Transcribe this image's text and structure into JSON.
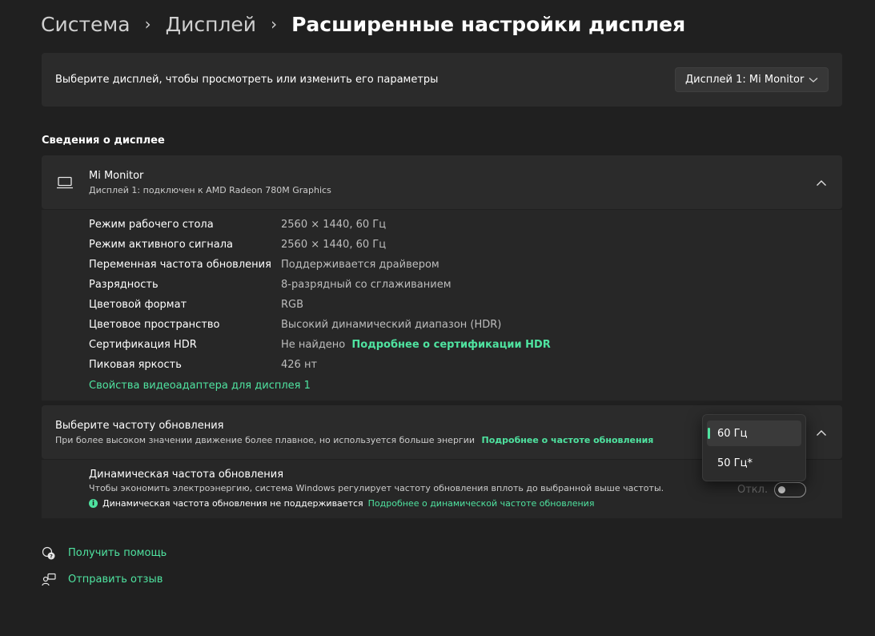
{
  "breadcrumb": {
    "items": [
      "Система",
      "Дисплей",
      "Расширенные настройки дисплея"
    ],
    "separator": "›"
  },
  "display_select": {
    "label": "Выберите дисплей, чтобы просмотреть или изменить его параметры",
    "value": "Дисплей 1: Mi Monitor"
  },
  "info_section": {
    "title": "Сведения о дисплее",
    "monitor_name": "Mi Monitor",
    "monitor_desc": "Дисплей 1: подключен к AMD Radeon 780M Graphics",
    "rows": [
      {
        "key": "Режим рабочего стола",
        "value": "2560 × 1440, 60 Гц"
      },
      {
        "key": "Режим активного сигнала",
        "value": "2560 × 1440, 60 Гц"
      },
      {
        "key": "Переменная частота обновления",
        "value": "Поддерживается драйвером"
      },
      {
        "key": "Разрядность",
        "value": "8-разрядный со сглаживанием"
      },
      {
        "key": "Цветовой формат",
        "value": "RGB"
      },
      {
        "key": "Цветовое пространство",
        "value": "Высокий динамический диапазон (HDR)"
      },
      {
        "key": "Сертификация HDR",
        "value": "Не найдено"
      },
      {
        "key": "Пиковая яркость",
        "value": "426 нт"
      }
    ],
    "hdr_link": "Подробнее о сертификации HDR",
    "adapter_link": "Свойства видеоадаптера для дисплея 1"
  },
  "refresh": {
    "title": "Выберите частоту обновления",
    "desc": "При более высоком значении движение более плавное, но используется больше энергии",
    "link": "Подробнее о частоте обновления",
    "options": [
      "60 Гц",
      "50 Гц*"
    ],
    "selected": "60 Гц"
  },
  "dynamic": {
    "title": "Динамическая частота обновления",
    "desc": "Чтобы экономить электроэнергию, система Windows регулирует частоту обновления вплоть до выбранной выше частоты.",
    "warning": "Динамическая частота обновления не поддерживается",
    "link": "Подробнее о динамической частоте обновления",
    "toggle_label": "Откл.",
    "toggle_on": false
  },
  "footer": {
    "help": "Получить помощь",
    "feedback": "Отправить отзыв"
  },
  "colors": {
    "accent": "#4fe3a0",
    "background": "#202020",
    "card": "#2b2b2b"
  }
}
